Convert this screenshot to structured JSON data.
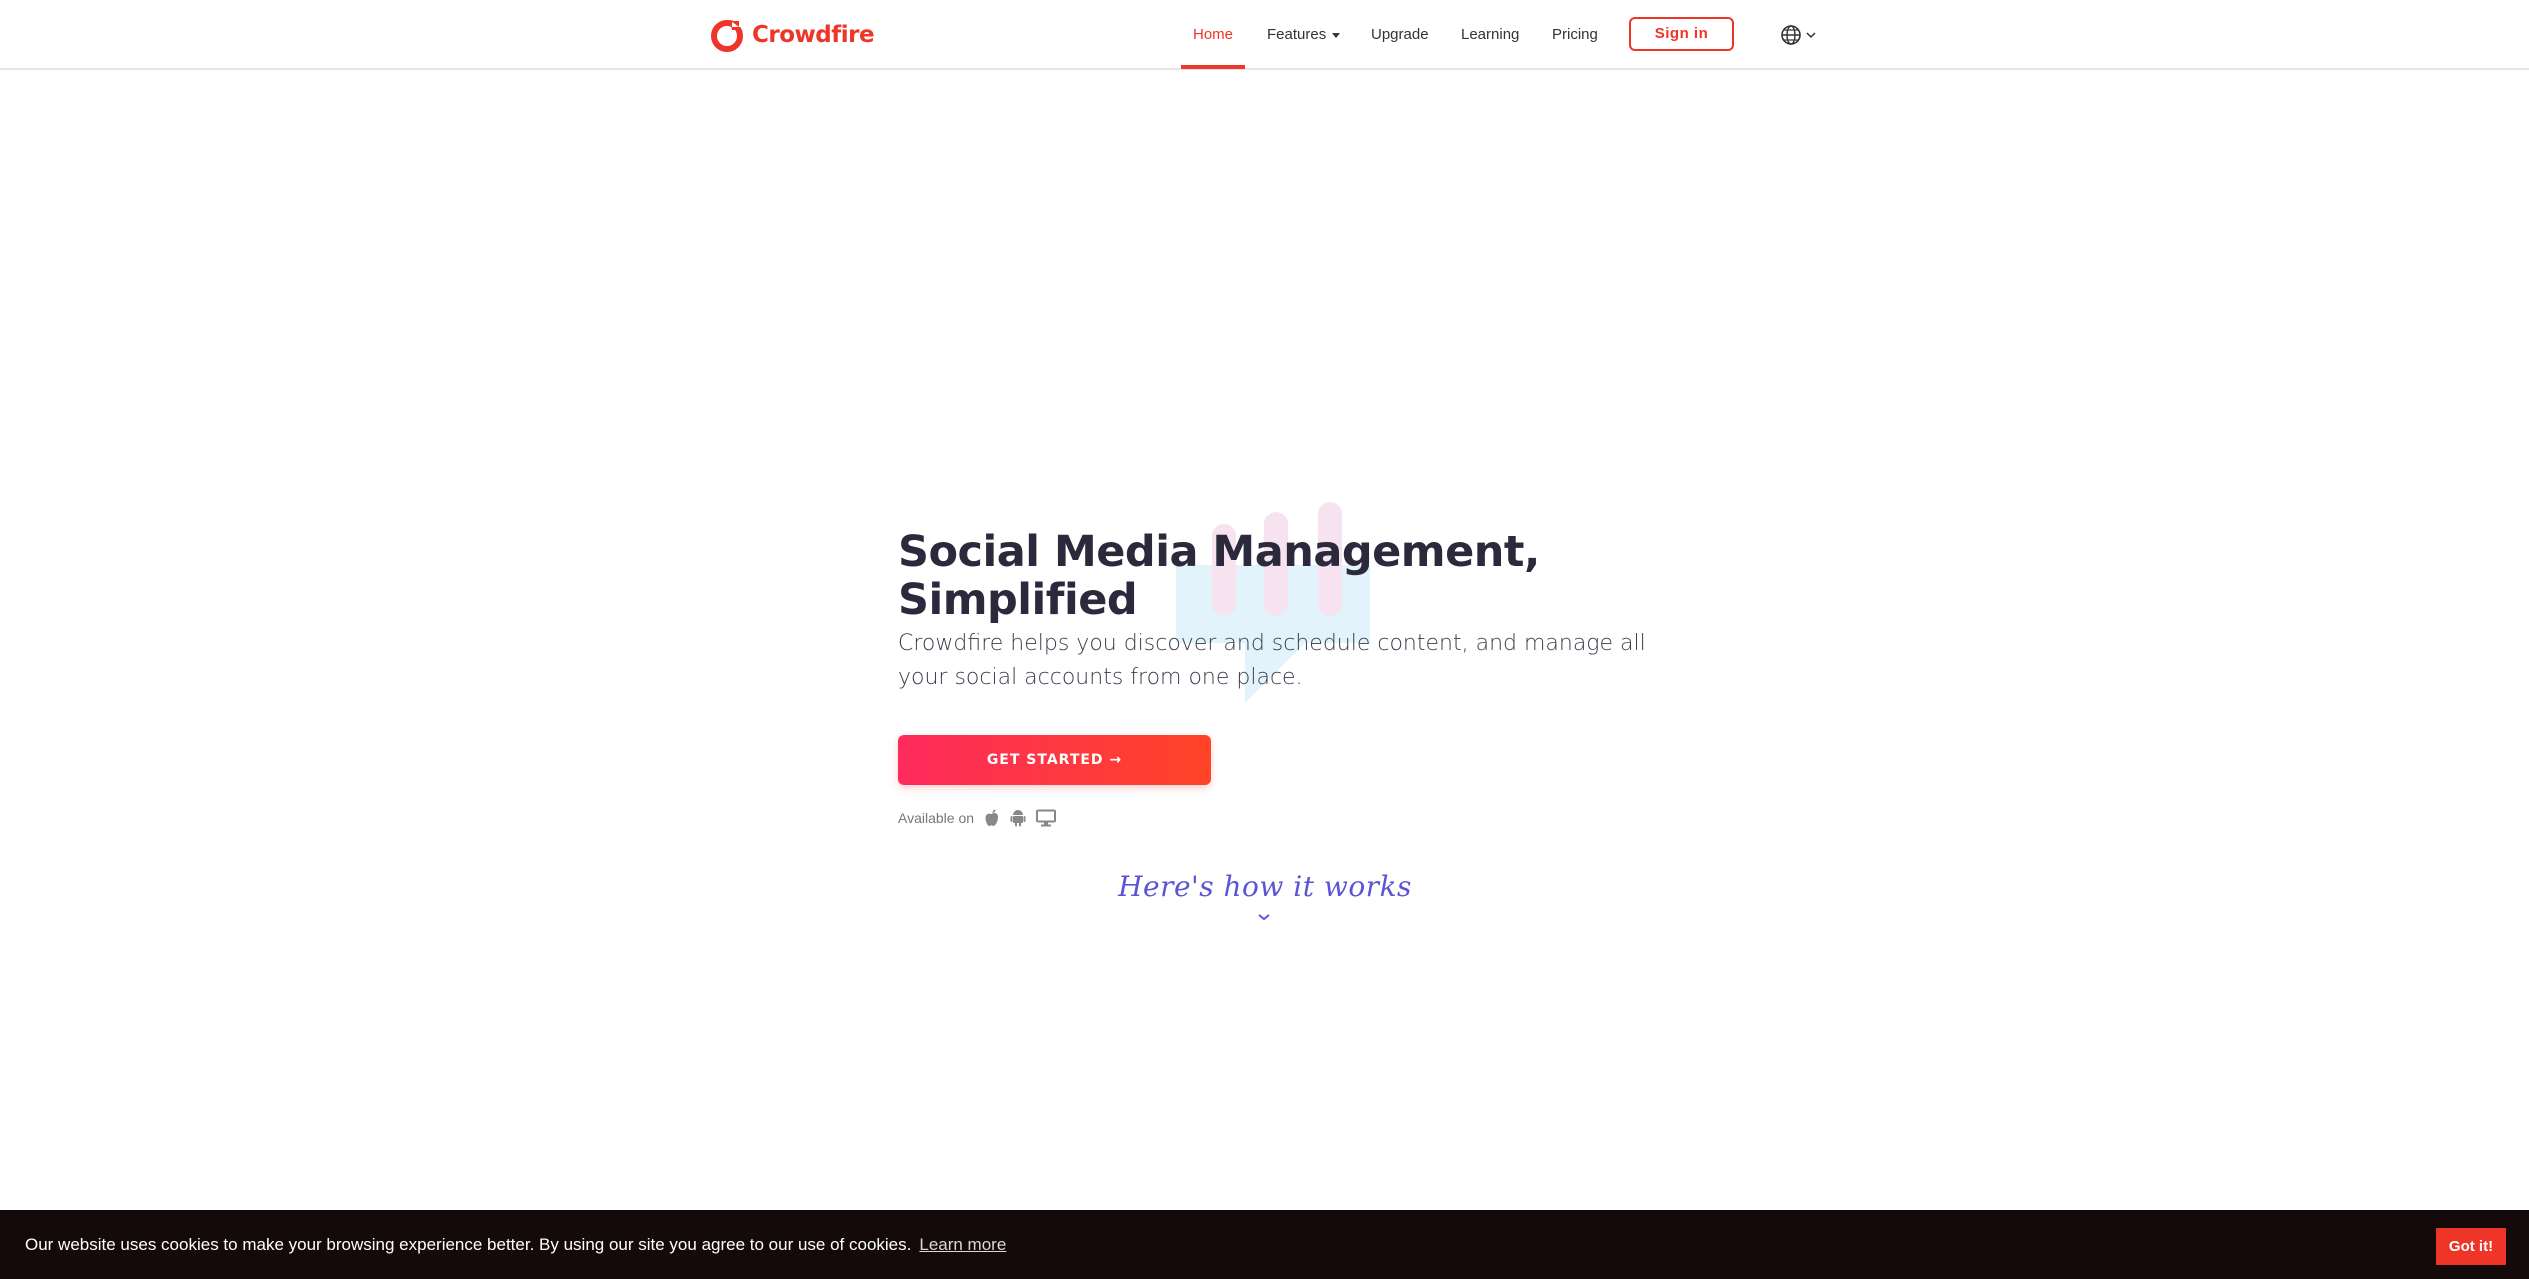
{
  "header": {
    "logo_text": "Crowdfire",
    "nav": [
      {
        "label": "Home",
        "active": true
      },
      {
        "label": "Features",
        "has_dropdown": true
      },
      {
        "label": "Upgrade"
      },
      {
        "label": "Learning"
      },
      {
        "label": "Pricing"
      }
    ],
    "signin_label": "Sign in",
    "language_icon": "globe-icon"
  },
  "hero": {
    "title_line1": "Social Media Management,",
    "title_line2": "Simplified",
    "subtitle": "Crowdfire helps you discover and schedule content, and manage all your social accounts from one place.",
    "cta_label": "GET STARTED →",
    "available_label": "Available on",
    "platform_icons": [
      "apple-icon",
      "android-icon",
      "desktop-icon"
    ],
    "how_it_works": "Here's how it works"
  },
  "cookie": {
    "text": "Our website uses cookies to make your browsing experience better. By using our site you agree to our use of cookies.",
    "learn_more": "Learn more",
    "accept_label": "Got it!"
  },
  "colors": {
    "brand": "#ee3528",
    "heading": "#2b2a3d",
    "cta_gradient_start": "#fe2b5d",
    "cta_gradient_end": "#ff4427",
    "accent_purple": "#5a56d3",
    "cookie_bar": "#140a09"
  }
}
